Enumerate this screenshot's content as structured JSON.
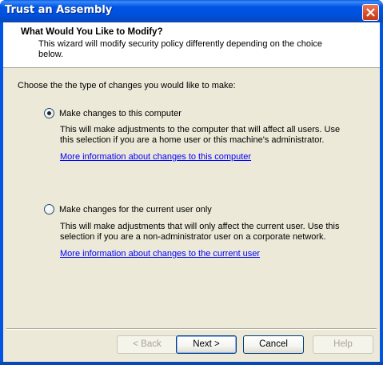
{
  "window": {
    "title": "Trust an Assembly"
  },
  "header": {
    "title": "What Would You Like to Modify?",
    "subtitle": "This wizard will modify security policy differently depending on the choice below."
  },
  "prompt": "Choose the the type of changes you would like to make:",
  "options": [
    {
      "label": "Make changes to this computer",
      "selected": true,
      "description": "This will make adjustments to the computer that will affect all users.  Use this selection if you are a home user or this machine's administrator.",
      "link": "More information about changes to this computer"
    },
    {
      "label": "Make changes for the current user only",
      "selected": false,
      "description": "This will make adjustments that will only affect the current user.  Use this selection if you are a non-administrator user on a corporate network.",
      "link": "More information about changes to the current user"
    }
  ],
  "buttons": {
    "back": "< Back",
    "next": "Next >",
    "cancel": "Cancel",
    "help": "Help"
  },
  "colors": {
    "titlebar": "#0055e5",
    "face": "#ece9d8",
    "link": "#0000ff"
  }
}
